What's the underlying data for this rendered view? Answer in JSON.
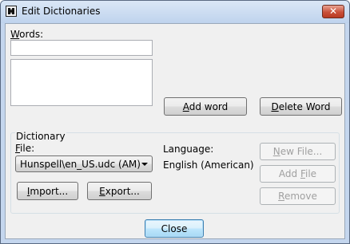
{
  "window": {
    "title": "Edit Dictionaries"
  },
  "words": {
    "label_pre": "",
    "label_u": "W",
    "label_post": "ords:",
    "input_value": "",
    "list_items": []
  },
  "buttons": {
    "add_word": {
      "pre": "",
      "u": "A",
      "post": "dd word"
    },
    "delete_word": {
      "pre": "",
      "u": "D",
      "post": "elete Word"
    },
    "import": {
      "pre": "",
      "u": "I",
      "post": "mport..."
    },
    "export": {
      "pre": "",
      "u": "E",
      "post": "xport..."
    },
    "new_file": {
      "pre": "",
      "u": "N",
      "post": "ew File..."
    },
    "add_file": {
      "pre": "Add ",
      "u": "F",
      "post": "ile"
    },
    "remove": {
      "pre": "",
      "u": "R",
      "post": "emove"
    },
    "close": {
      "pre": "Close",
      "u": "",
      "post": ""
    }
  },
  "dictionary": {
    "group_label": "Dictionary",
    "file_label_pre": "",
    "file_label_u": "F",
    "file_label_post": "ile:",
    "file_selected": "Hunspell\\en_US.udc (AM)",
    "language_label": "Language:",
    "language_value": "English (American)"
  },
  "icons": {
    "app": "dictionary-app-icon",
    "close": "close-icon",
    "dropdown": "chevron-down-icon"
  }
}
